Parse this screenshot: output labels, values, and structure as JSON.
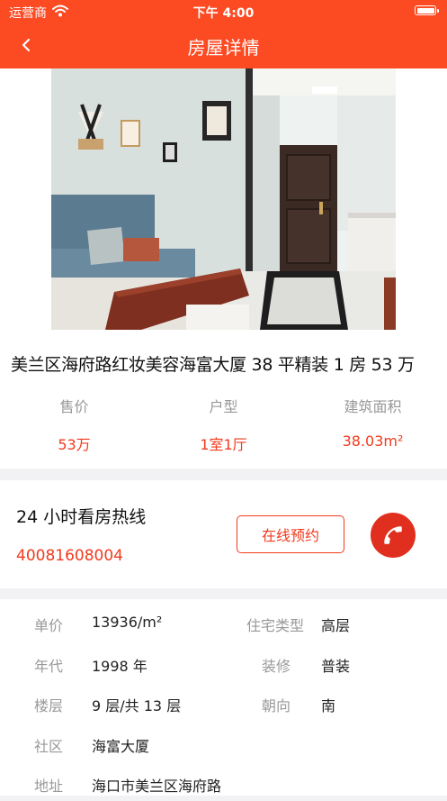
{
  "status_bar": {
    "carrier": "运营商",
    "time": "下午 4:00"
  },
  "nav": {
    "title": "房屋详情"
  },
  "listing": {
    "title": "美兰区海府路红妆美容海富大厦 38 平精装 1 房 53 万",
    "stats": [
      {
        "label": "售价",
        "value": "53万"
      },
      {
        "label": "户型",
        "value": "1室1厅"
      },
      {
        "label": "建筑面积",
        "value": "38.03m²"
      }
    ]
  },
  "hotline": {
    "title": "24 小时看房热线",
    "phone": "40081608004",
    "book_label": "在线预约"
  },
  "details": {
    "unit_price_label": "单价",
    "unit_price": "13936/m²",
    "house_type_label": "住宅类型",
    "house_type": "高层",
    "year_label": "年代",
    "year": "1998 年",
    "decoration_label": "装修",
    "decoration": "普装",
    "floor_label": "楼层",
    "floor": "9 层/共 13 层",
    "orientation_label": "朝向",
    "orientation": "南",
    "community_label": "社区",
    "community": "海富大厦",
    "address_label": "地址",
    "address": "海口市美兰区海府路"
  },
  "colors": {
    "brand": "#fc4a23",
    "accent_text": "#f23a1d",
    "call_button": "#e02f1e"
  },
  "icons": {
    "back": "chevron-left-icon",
    "call": "phone-icon",
    "wifi": "wifi-icon",
    "battery": "battery-icon"
  }
}
